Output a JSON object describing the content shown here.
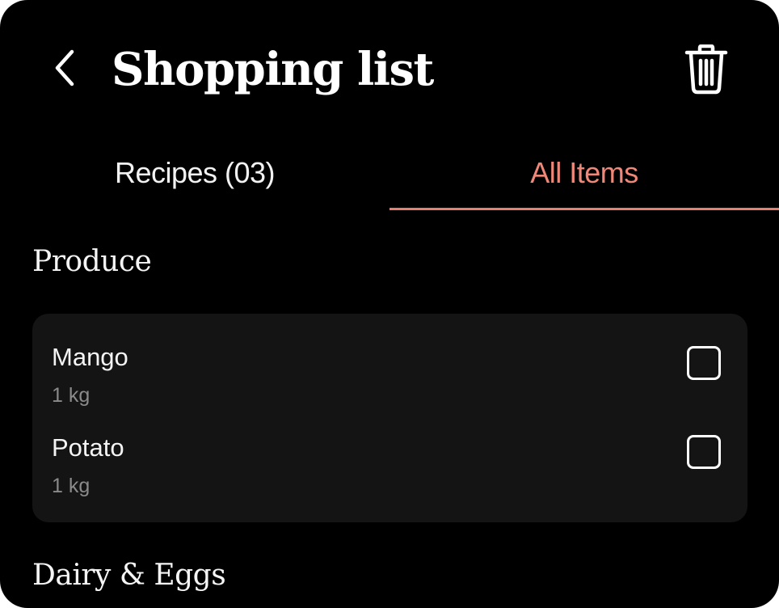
{
  "header": {
    "title": "Shopping list",
    "back_icon": "chevron-left-icon",
    "trash_icon": "trash-icon"
  },
  "tabs": [
    {
      "label": "Recipes (03)",
      "active": false
    },
    {
      "label": "All Items",
      "active": true
    }
  ],
  "colors": {
    "background": "#000000",
    "accent": "#ef8878",
    "card": "#141414",
    "muted_text": "#8a8a8a"
  },
  "sections": [
    {
      "heading": "Produce",
      "items": [
        {
          "name": "Mango",
          "quantity": "1 kg",
          "checked": false
        },
        {
          "name": "Potato",
          "quantity": "1 kg",
          "checked": false
        }
      ]
    },
    {
      "heading": "Dairy & Eggs",
      "items": []
    }
  ]
}
